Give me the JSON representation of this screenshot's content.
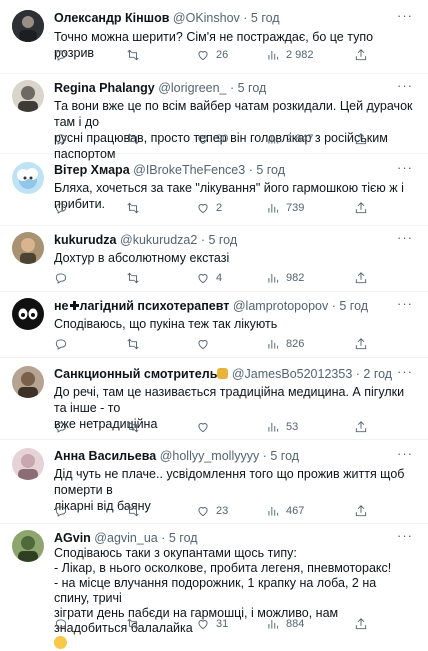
{
  "tweets": [
    {
      "name": "Олександр Кіншов",
      "handle": "@OKinshov",
      "time": "· 5 год",
      "lines": [
        "Точно можна шерити? Сім'я не постраждає, бо це тупо розрив"
      ],
      "stats": {
        "replies": "",
        "retweets": "",
        "likes": "26",
        "views": "2 982"
      },
      "avatar_color": "#3b3f44"
    },
    {
      "name": "Regina Phalangy",
      "handle": "@lorigreen_",
      "time": "· 5 год",
      "lines": [
        "Та вони вже це по всім вайбер чатам розкидали. Цей дурачок там і до",
        "русні працював, просто тепер він головлікар з російським паспортом"
      ],
      "stats": {
        "replies": "",
        "retweets": "",
        "likes": "90",
        "views": "2 847"
      },
      "avatar_color": "#6e6a63"
    },
    {
      "name": "Вітер Хмара",
      "handle": "@IBrokeTheFence3",
      "time": "· 5 год",
      "lines": [
        "Бляха, хочеться за таке \"лікування\" його гармошкою тією ж і прибити."
      ],
      "stats": {
        "replies": "",
        "retweets": "",
        "likes": "2",
        "views": "739"
      },
      "avatar_color": "#8fc7e8"
    },
    {
      "name": "kukurudza",
      "handle": "@kukurudza2",
      "time": "· 5 год",
      "lines": [
        "Дохтур в абсолютному екстазі"
      ],
      "stats": {
        "replies": "",
        "retweets": "",
        "likes": "4",
        "views": "982"
      },
      "avatar_color": "#7a6a52"
    },
    {
      "name_prefix": "не",
      "name_suffix": "лагідний психотерапевт",
      "handle": "@lamprotopopov",
      "time": "· 5 год",
      "lines": [
        "Сподіваюсь, що пукіна теж так лікують"
      ],
      "stats": {
        "replies": "",
        "retweets": "",
        "likes": "",
        "views": "826"
      },
      "avatar_color": "#111111"
    },
    {
      "name": "Санкционный смотритель",
      "handle": "@JamesBo52012353",
      "time": "· 2 год",
      "lines": [
        "До речі, там це називається традиційна медицина. А пігулки та інше - то",
        "вже нетрадиційна"
      ],
      "stats": {
        "replies": "",
        "retweets": "",
        "likes": "",
        "views": "53"
      },
      "avatar_color": "#8a6f5a"
    },
    {
      "name": "Анна Васильева",
      "handle": "@hollyy_mollyyyy",
      "time": "· 5 год",
      "lines": [
        "Дід чуть не плаче.. усвідомлення того що прожив життя щоб померти  в",
        "лікарні від баяну"
      ],
      "stats": {
        "replies": "",
        "retweets": "",
        "likes": "23",
        "views": "467"
      },
      "avatar_color": "#c9a7b0"
    },
    {
      "name": "AGvin",
      "handle": "@agvin_ua",
      "time": "· 5 год",
      "lines": [
        "Сподіваюсь таки з окупантами щось типу:",
        "- Лікар, в нього осколкове, пробита легеня, пневмоторакс!",
        "- на місце влучання подорожник, 1 крапку на лоба, 2 на спину, тричі",
        "зіграти день пабєди на гармошці, і можливо, нам знадобиться балалайка"
      ],
      "stats": {
        "replies": "",
        "retweets": "",
        "likes": "31",
        "views": "884"
      },
      "avatar_color": "#4f6a3a"
    }
  ]
}
